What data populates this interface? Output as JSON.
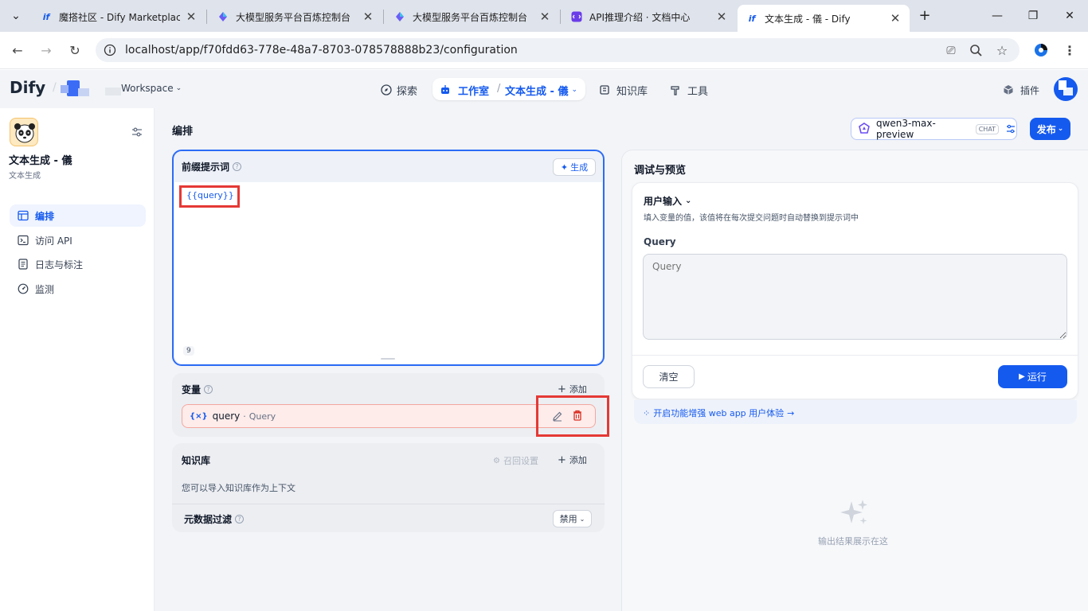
{
  "browser": {
    "tabs": [
      {
        "title": "魔搭社区 - Dify Marketplac",
        "favicon": "dify"
      },
      {
        "title": "大模型服务平台百炼控制台",
        "favicon": "bailian"
      },
      {
        "title": "大模型服务平台百炼控制台",
        "favicon": "bailian"
      },
      {
        "title": "API推理介绍 · 文档中心",
        "favicon": "docs"
      },
      {
        "title": "文本生成 - 儀 - Dify",
        "favicon": "dify"
      }
    ],
    "url": "localhost/app/f70fdd63-778e-48a7-8703-078578888b23/configuration"
  },
  "header": {
    "logo": "Dify",
    "workspace": "Workspace",
    "nav": {
      "explore": "探索",
      "studio": "工作室",
      "app_name": "文本生成 - 儀",
      "knowledge": "知识库",
      "tools": "工具",
      "plugins": "插件"
    }
  },
  "sidebar": {
    "app_title": "文本生成 - 儀",
    "app_type": "文本生成",
    "items": [
      {
        "label": "编排",
        "icon": "layout-icon",
        "active": true
      },
      {
        "label": "访问 API",
        "icon": "terminal-icon",
        "active": false
      },
      {
        "label": "日志与标注",
        "icon": "document-icon",
        "active": false
      },
      {
        "label": "监测",
        "icon": "gauge-icon",
        "active": false
      }
    ]
  },
  "main": {
    "title": "编排",
    "model": {
      "name": "qwen3-max-preview",
      "badge": "CHAT"
    },
    "publish_label": "发布",
    "prompt": {
      "title": "前缀提示词",
      "generate_label": "生成",
      "content": "{{query}}",
      "char_count": "9"
    },
    "variables": {
      "title": "变量",
      "add_label": "添加",
      "items": [
        {
          "key": "query",
          "name": "Query"
        }
      ]
    },
    "knowledge": {
      "title": "知识库",
      "recall_settings": "召回设置",
      "add_label": "添加",
      "hint": "您可以导入知识库作为上下文",
      "metadata_filter": "元数据过滤",
      "metadata_value": "禁用"
    }
  },
  "preview": {
    "title": "调试与预览",
    "user_input_title": "用户输入",
    "user_input_hint": "填入变量的值，该值将在每次提交问题时自动替换到提示词中",
    "field_label": "Query",
    "field_placeholder": "Query",
    "clear_label": "清空",
    "run_label": "运行",
    "feature_link": "开启功能增强 web app 用户体验",
    "empty_text": "输出结果展示在这"
  },
  "colors": {
    "accent": "#155aef",
    "highlight": "#e53935",
    "prompt_border": "#2c6cf6"
  }
}
